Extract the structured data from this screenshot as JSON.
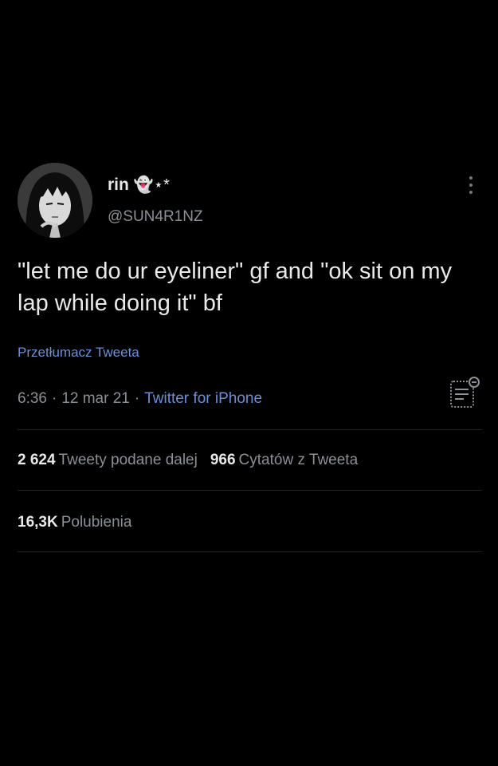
{
  "tweet": {
    "display_name": "rin",
    "display_name_emoji": "👻⋆*",
    "handle": "@SUN4R1NZ",
    "text": "\"let me do ur eyeliner\" gf and \"ok sit on my lap while doing it\" bf",
    "translate_label": "Przetłumacz Tweeta",
    "time": "6:36",
    "date": "12 mar 21",
    "separator": "·",
    "source": "Twitter for iPhone"
  },
  "stats": {
    "retweets_count": "2 624",
    "retweets_label": "Tweety podane dalej",
    "quotes_count": "966",
    "quotes_label": "Cytatów z Tweeta",
    "likes_count": "16,3K",
    "likes_label": "Polubienia"
  },
  "icons": {
    "more": "more-vertical-icon",
    "analytics": "tweet-analytics-icon"
  },
  "colors": {
    "background": "#000000",
    "text": "#e7e9ea",
    "secondary": "#8b9096",
    "link": "#6b8fd6",
    "divider": "#202327"
  }
}
